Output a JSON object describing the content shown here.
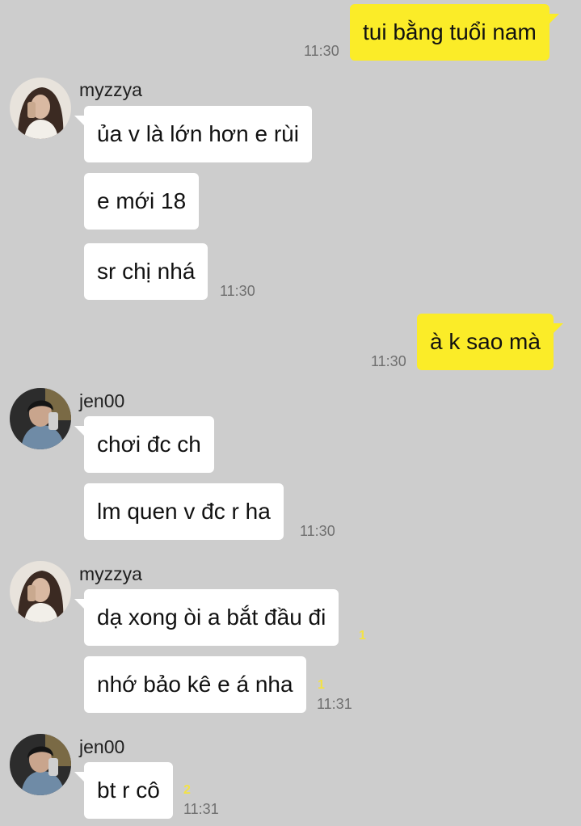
{
  "messages": [
    {
      "text": "tui bằng tuổi nam",
      "time": "11:30"
    },
    {
      "sender": "myzzya",
      "text": "ủa v là lớn hơn e rùi"
    },
    {
      "text": "e mới 18"
    },
    {
      "text": "sr chị nhá",
      "time": "11:30"
    },
    {
      "text": "à k sao mà",
      "time": "11:30"
    },
    {
      "sender": "jen00",
      "text": "chơi đc ch"
    },
    {
      "text": "lm quen v đc r ha",
      "time": "11:30"
    },
    {
      "sender": "myzzya",
      "text": "dạ xong òi a bắt đầu đi",
      "unread": "1"
    },
    {
      "text": "nhớ bảo kê e á nha",
      "unread": "1",
      "time": "11:31"
    },
    {
      "sender": "jen00",
      "text": "bt r cô",
      "unread": "2",
      "time": "11:31"
    }
  ],
  "colors": {
    "background": "#cdcdcd",
    "incoming_bubble": "#ffffff",
    "outgoing_bubble": "#fbec28",
    "unread_count": "#f3e245"
  },
  "icons": {
    "avatar_myzzya": "avatar-photo-girl",
    "avatar_jen00": "avatar-photo-boy"
  }
}
